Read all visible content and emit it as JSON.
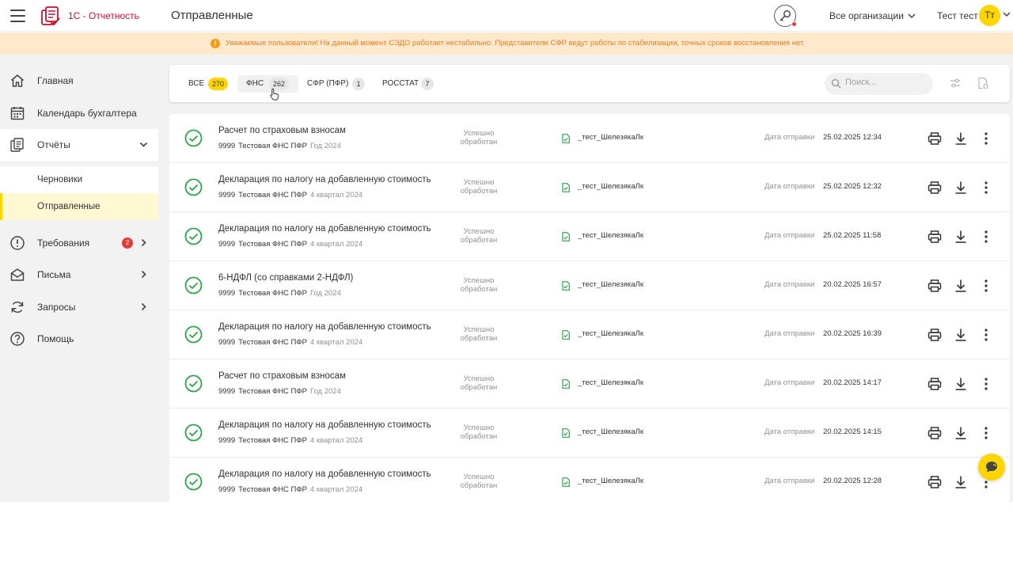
{
  "app": {
    "brand": "1С - Отчетность",
    "page_title": "Отправленные",
    "organizations_label": "Все организации",
    "user_name": "Тест тест",
    "user_initials": "Тт",
    "accent_color": "#ffd500",
    "brand_color": "#c8102e"
  },
  "notice": {
    "text": "Уважаемые пользователи! На данный момент СЭДО работает нестабильно. Представители СФР ведут работы по стабилизации, точных сроков восстановления нет."
  },
  "sidebar": {
    "items": [
      {
        "label": "Главная",
        "icon": "home-icon"
      },
      {
        "label": "Календарь бухгалтера",
        "icon": "calendar-icon"
      },
      {
        "label": "Отчёты",
        "icon": "reports-icon",
        "expanded": true
      },
      {
        "label": "Требования",
        "icon": "alert-circle-icon",
        "badge": "2"
      },
      {
        "label": "Письма",
        "icon": "mail-icon"
      },
      {
        "label": "Запросы",
        "icon": "refresh-icon"
      },
      {
        "label": "Помощь",
        "icon": "help-icon"
      }
    ],
    "subitems": [
      {
        "label": "Черновики"
      },
      {
        "label": "Отправленные",
        "active": true
      }
    ]
  },
  "filters": {
    "tabs": [
      {
        "label": "ВСЕ",
        "count": "270",
        "selected": true
      },
      {
        "label": "ФНС",
        "count": "262"
      },
      {
        "label": "СФР (ПФР)",
        "count": "1"
      },
      {
        "label": "РОССТАТ",
        "count": "7"
      }
    ],
    "search_placeholder": "Поиск..."
  },
  "reports": {
    "status_line1": "Успешно",
    "status_line2": "обработан",
    "date_label": "Дата отправки",
    "rows": [
      {
        "title": "Расчет по страховым взносам",
        "inn": "9999",
        "org": "Тестовая ФНС ПФР",
        "period": "Год 2024",
        "file": "_тест_ШелезякаЛк",
        "date": "25.02.2025 12:34"
      },
      {
        "title": "Декларация по налогу на добавленную стоимость",
        "inn": "9999",
        "org": "Тестовая ФНС ПФР",
        "period": "4 квартал 2024",
        "file": "_тест_ШелезякаЛк",
        "date": "25.02.2025 12:32"
      },
      {
        "title": "Декларация по налогу на добавленную стоимость",
        "inn": "9999",
        "org": "Тестовая ФНС ПФР",
        "period": "4 квартал 2024",
        "file": "_тест_ШелезякаЛк",
        "date": "25.02.2025 11:58"
      },
      {
        "title": "6-НДФЛ (со справками 2-НДФЛ)",
        "inn": "9999",
        "org": "Тестовая ФНС ПФР",
        "period": "Год 2024",
        "file": "_тест_ШелезякаЛк",
        "date": "20.02.2025 16:57"
      },
      {
        "title": "Декларация по налогу на добавленную стоимость",
        "inn": "9999",
        "org": "Тестовая ФНС ПФР",
        "period": "4 квартал 2024",
        "file": "_тест_ШелезякаЛк",
        "date": "20.02.2025 16:39"
      },
      {
        "title": "Расчет по страховым взносам",
        "inn": "9999",
        "org": "Тестовая ФНС ПФР",
        "period": "Год 2024",
        "file": "_тест_ШелезякаЛк",
        "date": "20.02.2025 14:17"
      },
      {
        "title": "Декларация по налогу на добавленную стоимость",
        "inn": "9999",
        "org": "Тестовая ФНС ПФР",
        "period": "4 квартал 2024",
        "file": "_тест_ШелезякаЛк",
        "date": "20.02.2025 14:15"
      },
      {
        "title": "Декларация по налогу на добавленную стоимость",
        "inn": "9999",
        "org": "Тестовая ФНС ПФР",
        "period": "4 квартал 2024",
        "file": "_тест_ШелезякаЛк",
        "date": "20.02.2025 12:28"
      }
    ]
  }
}
